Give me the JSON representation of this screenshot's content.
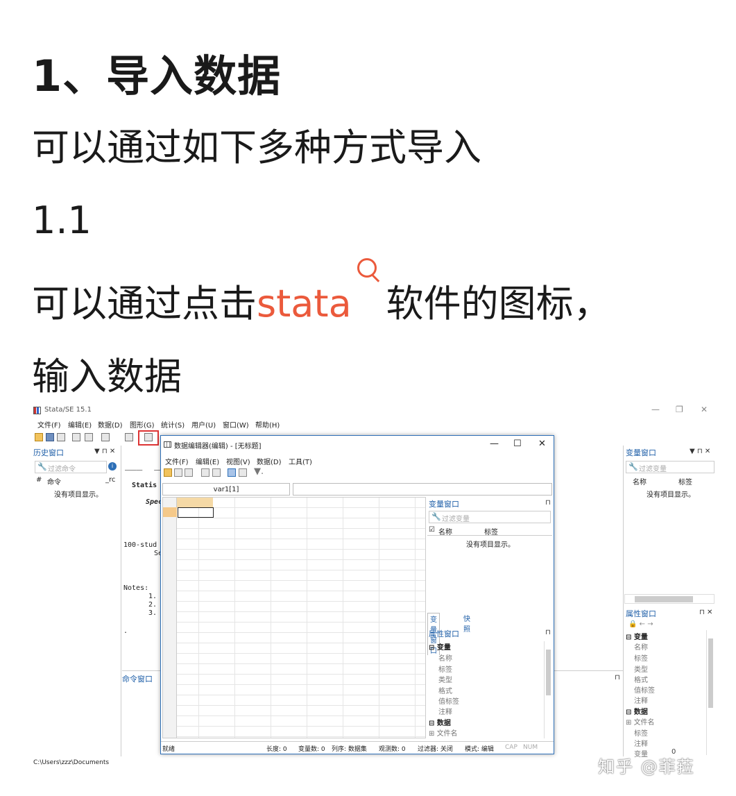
{
  "article": {
    "heading": "1、导入数据",
    "line1": "可以通过如下多种方式导入",
    "line2": "1.1",
    "line3_before": "可以通过点击",
    "line3_link": "stata",
    "line3_after": "软件的图标，",
    "line4": "输入数据",
    "link_color": "#eb5a3c"
  },
  "stata": {
    "app_title": "Stata/SE 15.1",
    "window_controls": [
      "—",
      "❐",
      "✕"
    ],
    "menu": [
      "文件(F)",
      "编辑(E)",
      "数据(D)",
      "图形(G)",
      "统计(S)",
      "用户(U)",
      "窗口(W)",
      "帮助(H)"
    ],
    "history": {
      "title": "历史窗口",
      "controls": "▼ ⊓ ✕",
      "filter_placeholder": "过滤命令",
      "col_num": "#",
      "col_cmd": "命令",
      "col_rc": "_rc",
      "empty": "没有项目显示。"
    },
    "results": {
      "logo_fragment": "___  ____",
      "line_statis": "Statis",
      "line_spec": "Spec",
      "line_100": "100-stud",
      "line_se": "Se",
      "notes": "Notes:",
      "n1": "1.",
      "n2": "2.",
      "n3": "3.",
      "dot": "."
    },
    "command_window": "命令窗口",
    "status_path": "C:\\Users\\zzz\\Documents",
    "variables": {
      "title": "变量窗口",
      "controls": "▼ ⊓ ✕",
      "filter_placeholder": "过滤变量",
      "col_name": "名称",
      "col_label": "标签",
      "empty": "没有项目显示。"
    },
    "properties": {
      "title": "属性窗口",
      "controls": "⊓ ✕",
      "group_var": "变量",
      "var_rows": [
        "名称",
        "标签",
        "类型",
        "格式",
        "值标签",
        "注释"
      ],
      "group_data": "数据",
      "data_rows": [
        "文件名",
        "标签",
        "注释",
        "变量"
      ],
      "last_value": "0"
    }
  },
  "editor": {
    "title": "数据编辑器(编辑) - [无标题]",
    "controls": [
      "—",
      "☐",
      "✕"
    ],
    "menu": [
      "文件(F)",
      "编辑(E)",
      "视图(V)",
      "数据(D)",
      "工具(T)"
    ],
    "cell_ref": "var1[1]",
    "var_panel": {
      "title": "变量窗口",
      "filter_placeholder": "过滤变量",
      "col_name": "名称",
      "col_label": "标签",
      "empty": "没有项目显示。"
    },
    "tabs": [
      "变量窗口",
      "快照"
    ],
    "prop_panel": {
      "title": "属性窗口",
      "group_var": "变量",
      "var_rows": [
        "名称",
        "标签",
        "类型",
        "格式",
        "值标签",
        "注释"
      ],
      "group_data": "数据",
      "data_rows": [
        "文件名"
      ]
    },
    "status": {
      "ready": "就绪",
      "length": "长度: 0",
      "vars": "变量数: 0",
      "order": "列序: 数据集",
      "obs": "观测数: 0",
      "filter": "过滤器: 关闭",
      "mode": "模式: 编辑",
      "cap": "CAP",
      "num": "NUM"
    }
  },
  "watermark": "知乎 @菲菈"
}
